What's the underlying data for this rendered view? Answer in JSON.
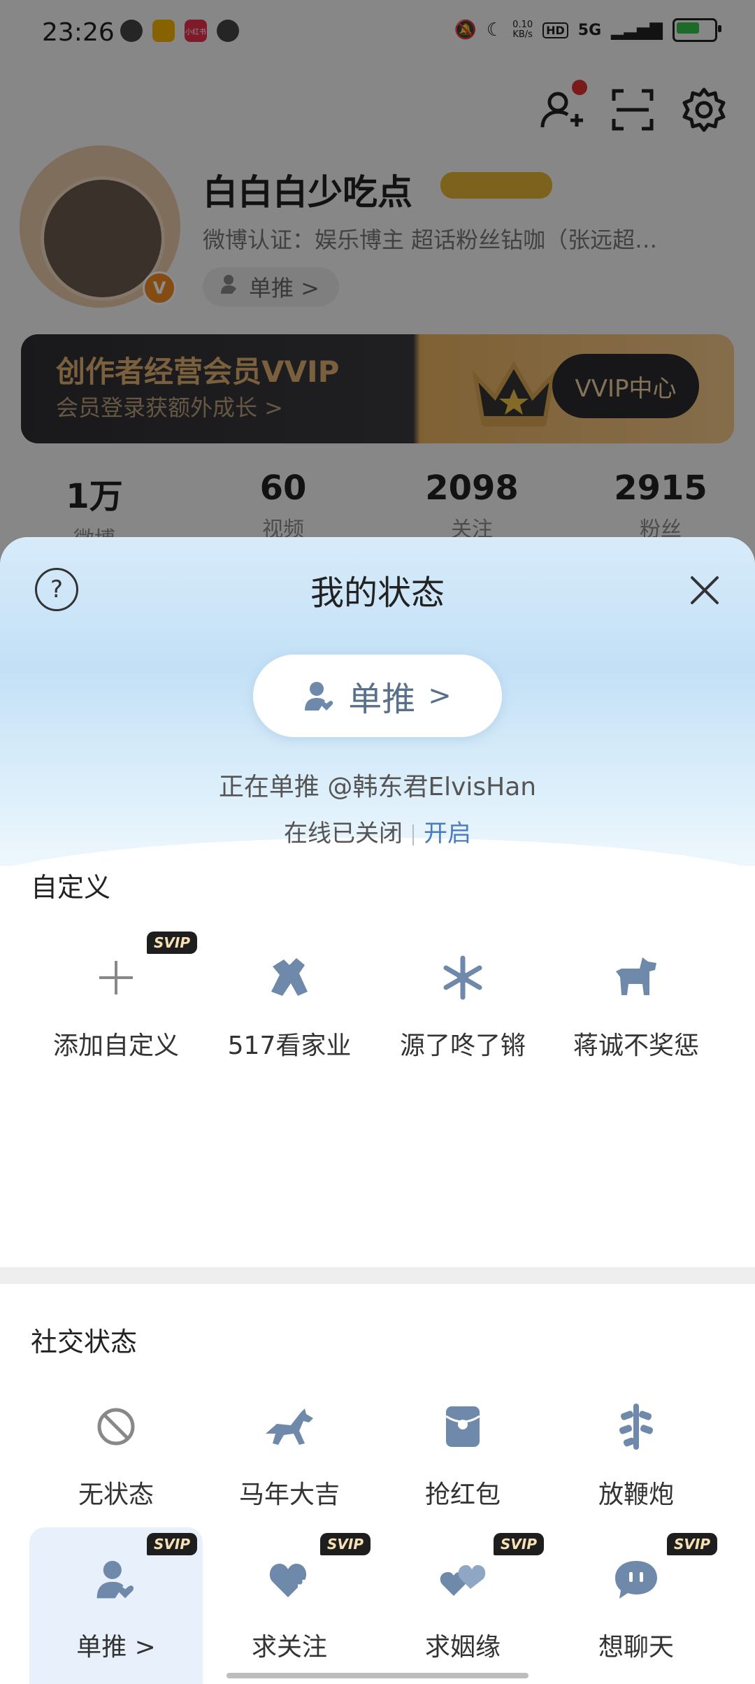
{
  "status_bar": {
    "time": "23:26",
    "net_speed_value": "0.10",
    "net_speed_unit": "KB/s",
    "hd": "HD",
    "network": "5G",
    "app_icons": [
      {
        "name": "globe-icon",
        "color": "#444444",
        "text": ""
      },
      {
        "name": "weibo-app-icon",
        "color": "#f5b400",
        "text": ""
      },
      {
        "name": "xiaohongshu-app-icon",
        "color": "#e8314f",
        "text": "小红书"
      },
      {
        "name": "wechat-icon",
        "color": "#444444",
        "text": ""
      }
    ]
  },
  "profile": {
    "username": "白白白少吃点",
    "verification": "微博认证：娱乐博主 超话粉丝钻咖（张远超…",
    "status_chip": "单推 >",
    "verified_badge": "V",
    "vvip": {
      "title": "创作者经营会员VVIP",
      "subtitle": "会员登录获额外成长 >",
      "button": "VVIP中心"
    },
    "stats": [
      {
        "value": "1万",
        "label": "微博"
      },
      {
        "value": "60",
        "label": "视频"
      },
      {
        "value": "2098",
        "label": "关注"
      },
      {
        "value": "2915",
        "label": "粉丝"
      }
    ]
  },
  "sheet": {
    "help_icon_text": "?",
    "title": "我的状态",
    "status_pill_label": "单推",
    "status_pill_arrow": ">",
    "following_text": "正在单推 @韩东君ElvisHan",
    "online_text": "在线已关闭",
    "online_open": "开启",
    "custom_section": {
      "title": "自定义",
      "items": [
        {
          "label": "添加自定义",
          "icon": "plus-icon",
          "svip": "SVIP"
        },
        {
          "label": "517看家业",
          "icon": "figure-icon",
          "svip": ""
        },
        {
          "label": "源了咚了锵",
          "icon": "snowflake-icon",
          "svip": ""
        },
        {
          "label": "蒋诚不奖惩",
          "icon": "dog-icon",
          "svip": ""
        }
      ]
    },
    "social_section": {
      "title": "社交状态",
      "row1": [
        {
          "label": "无状态",
          "icon": "no-status-icon"
        },
        {
          "label": "马年大吉",
          "icon": "horse-icon"
        },
        {
          "label": "抢红包",
          "icon": "red-envelope-icon"
        },
        {
          "label": "放鞭炮",
          "icon": "firecracker-icon"
        }
      ],
      "row2": [
        {
          "label": "单推 >",
          "icon": "single-push-icon",
          "svip": "SVIP"
        },
        {
          "label": "求关注",
          "icon": "heart-plus-icon",
          "svip": "SVIP"
        },
        {
          "label": "求姻缘",
          "icon": "double-heart-icon",
          "svip": "SVIP"
        },
        {
          "label": "想聊天",
          "icon": "chat-bubble-icon",
          "svip": "SVIP"
        }
      ]
    }
  },
  "colors": {
    "icon_blue": "#6f89ab",
    "link_blue": "#4a7bbf",
    "svip_bg": "#1e1e1e",
    "svip_text": "#f6e0b5"
  }
}
